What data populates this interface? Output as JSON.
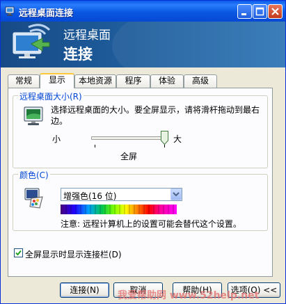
{
  "window": {
    "title": "远程桌面连接",
    "controls": {
      "minimize": "minimize",
      "maximize": "maximize",
      "close": "close"
    }
  },
  "banner": {
    "line1": "远程桌面",
    "line2": "连接"
  },
  "tabs": [
    {
      "label": "常规",
      "active": false
    },
    {
      "label": "显示",
      "active": true
    },
    {
      "label": "本地资源",
      "active": false
    },
    {
      "label": "程序",
      "active": false
    },
    {
      "label": "体验",
      "active": false
    },
    {
      "label": "高级",
      "active": false
    }
  ],
  "display_size": {
    "legend": "远程桌面大小(R)",
    "description": "选择远程桌面的大小。要全屏显示，请将滑杆拖动到最右边。",
    "desc_line1": "选择远程桌面的大小。要全屏显示，请将滑杆拖动到最右",
    "desc_line2": "边。",
    "min_label": "小",
    "max_label": "大",
    "value_label": "全屏",
    "slider_value": 1.0
  },
  "colors": {
    "legend": "颜色(C)",
    "selected": "增强色(16 位)",
    "note": "注意: 远程计算机上的设置可能会替代这个设置。"
  },
  "options": {
    "show_connection_bar_label": "全屏显示时显示连接栏(D)",
    "show_connection_bar_checked": true
  },
  "buttons": {
    "connect": "连接(N)",
    "cancel": "取消",
    "help": "帮助(H)",
    "options": "选项(O) <<"
  },
  "watermark": "我爱帮助网 www.52help.net",
  "icons": {
    "title_icon": "remote-desktop-icon",
    "banner_logo": "remote-desktop-logo",
    "monitor": "monitor-icon",
    "palette": "color-palette-icon"
  }
}
